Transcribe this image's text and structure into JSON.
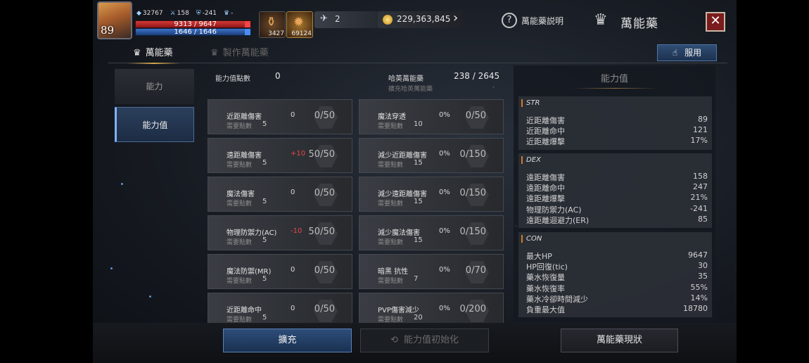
{
  "hud": {
    "level": "89",
    "stat_a": "32767",
    "stat_b": "158",
    "stat_c": "-241",
    "stat_d": "-",
    "hp": "9313 / 9647",
    "mp": "1646 / 1646",
    "potion1_count": "3427",
    "potion2_count": "69124",
    "feather_count": "2",
    "gold": "229,363,845",
    "help_label": "萬能藥説明",
    "window_title": "萬能藥",
    "close_symbol": "✕"
  },
  "tabs": {
    "active_label": "萬能藥",
    "inactive_label": "製作萬能藥",
    "use_label": "服用"
  },
  "sidebar": {
    "items": [
      {
        "label": "能力"
      },
      {
        "label": "能力值"
      }
    ]
  },
  "header": {
    "points_label": "能力值點數",
    "points_value": "0",
    "hh_label": "哈英萬能藥",
    "hh_value": "238 / 2645",
    "hh_sub": "擴充哈英萬能藥",
    "hh_dash": "-"
  },
  "cards": [
    {
      "name": "近距離傷害",
      "req_label": "需要點數",
      "req": "5",
      "bonus": "0",
      "progress": "0/50"
    },
    {
      "name": "魔法穿透",
      "req_label": "需要點數",
      "req": "10",
      "bonus": "0%",
      "progress": "0/50"
    },
    {
      "name": "遠距離傷害",
      "req_label": "需要點數",
      "req": "5",
      "bonus": "+10",
      "progress": "50/50"
    },
    {
      "name": "減少近距離傷害",
      "req_label": "需要點數",
      "req": "15",
      "bonus": "0%",
      "progress": "0/150"
    },
    {
      "name": "魔法傷害",
      "req_label": "需要點數",
      "req": "5",
      "bonus": "0",
      "progress": "0/50"
    },
    {
      "name": "減少遠距離傷害",
      "req_label": "需要點數",
      "req": "15",
      "bonus": "0%",
      "progress": "0/150"
    },
    {
      "name": "物理防禦力(AC)",
      "req_label": "需要點數",
      "req": "5",
      "bonus": "-10",
      "progress": "50/50"
    },
    {
      "name": "減少魔法傷害",
      "req_label": "需要點數",
      "req": "15",
      "bonus": "0%",
      "progress": "0/150"
    },
    {
      "name": "魔法防禦(MR)",
      "req_label": "需要點數",
      "req": "5",
      "bonus": "0",
      "progress": "0/50"
    },
    {
      "name": "暗黑 抗性",
      "req_label": "需要點數",
      "req": "7",
      "bonus": "0%",
      "progress": "0/70"
    },
    {
      "name": "近距離命中",
      "req_label": "需要點數",
      "req": "5",
      "bonus": "0",
      "progress": "0/50"
    },
    {
      "name": "PVP傷害減少",
      "req_label": "需要點數",
      "req": "20",
      "bonus": "0%",
      "progress": "0/200"
    }
  ],
  "right_panel": {
    "title": "能力值",
    "sections": [
      {
        "name": "STR",
        "rows": [
          {
            "label": "近距離傷害",
            "value": "89"
          },
          {
            "label": "近距離命中",
            "value": "121"
          },
          {
            "label": "近距離爆擊",
            "value": "17%"
          }
        ]
      },
      {
        "name": "DEX",
        "rows": [
          {
            "label": "遠距離傷害",
            "value": "158"
          },
          {
            "label": "遠距離命中",
            "value": "247"
          },
          {
            "label": "遠距離爆擊",
            "value": "21%"
          },
          {
            "label": "物理防禦力(AC)",
            "value": "-241"
          },
          {
            "label": "遠距離迴避力(ER)",
            "value": "85"
          }
        ]
      },
      {
        "name": "CON",
        "rows": [
          {
            "label": "最大HP",
            "value": "9647"
          },
          {
            "label": "HP回復(tic)",
            "value": "30"
          },
          {
            "label": "藥水恢復量",
            "value": "35"
          },
          {
            "label": "藥水恢復率",
            "value": "55%"
          },
          {
            "label": "藥水冷卻時間減少",
            "value": "14%"
          },
          {
            "label": "負重最大值",
            "value": "18780"
          }
        ]
      }
    ]
  },
  "bottom": {
    "expand_label": "擴充",
    "reset_label": "能力值初始化",
    "status_label": "萬能藥現狀"
  }
}
